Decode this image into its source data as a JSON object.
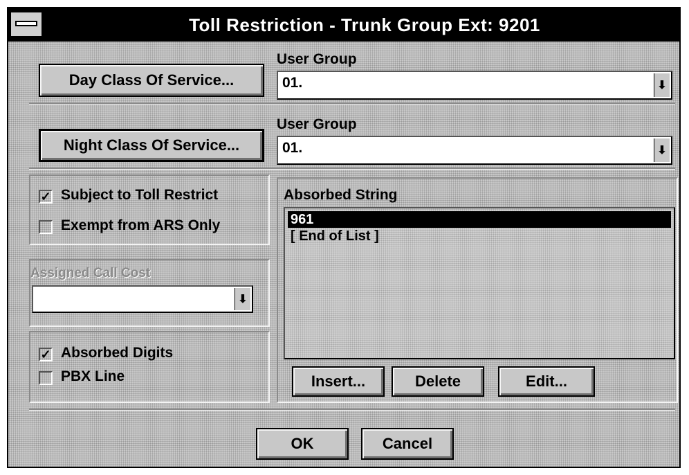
{
  "window": {
    "title": "Toll Restriction - Trunk Group Ext:  9201"
  },
  "day": {
    "button_label": "Day Class Of Service...",
    "group_label": "User Group",
    "group_value": "01."
  },
  "night": {
    "button_label": "Night Class Of Service...",
    "group_label": "User Group",
    "group_value": "01."
  },
  "options": {
    "toll_restrict": {
      "label": "Subject to Toll Restrict",
      "checked": true
    },
    "exempt_ars": {
      "label": "Exempt from ARS Only",
      "checked": false
    }
  },
  "call_cost": {
    "label": "Assigned Call Cost",
    "value": ""
  },
  "digits": {
    "absorbed": {
      "label": "Absorbed Digits",
      "checked": true
    },
    "pbx_line": {
      "label": "PBX Line",
      "checked": false
    }
  },
  "absorbed_string": {
    "label": "Absorbed String",
    "items": [
      "961",
      "[ End of List ]"
    ],
    "selected_index": 0
  },
  "buttons": {
    "insert": "Insert...",
    "delete": "Delete",
    "edit": "Edit...",
    "ok": "OK",
    "cancel": "Cancel"
  },
  "icons": {
    "system_menu": "system-menu-icon",
    "dropdown": "dropdown-arrow-icon",
    "check": "✓"
  }
}
